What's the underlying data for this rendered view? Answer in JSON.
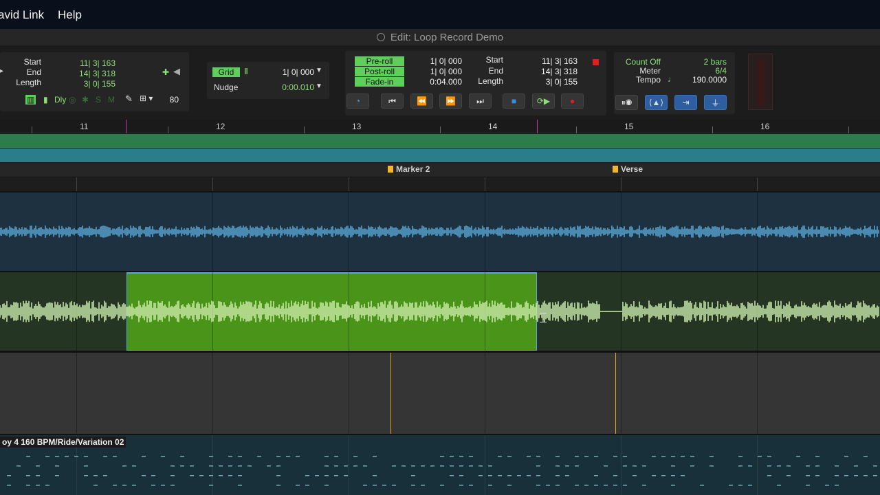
{
  "menu": {
    "items": [
      "avid Link",
      "Help"
    ]
  },
  "window": {
    "title": "Edit: Loop Record Demo"
  },
  "edit_selection": {
    "start_label": "Start",
    "start_value": "11| 3| 163",
    "end_label": "End",
    "end_value": "14| 3| 318",
    "length_label": "Length",
    "length_value": "3| 0| 155",
    "dly_label": "Dly",
    "s_label": "S",
    "m_label": "M",
    "zoom_value": "80"
  },
  "grid_nudge": {
    "grid_label": "Grid",
    "grid_value": "1| 0| 000",
    "nudge_label": "Nudge",
    "nudge_value": "0:00.010"
  },
  "transport": {
    "preroll_label": "Pre-roll",
    "preroll_value": "1| 0| 000",
    "postroll_label": "Post-roll",
    "postroll_value": "1| 0| 000",
    "fadein_label": "Fade-in",
    "fadein_value": "0:04.000",
    "start_label": "Start",
    "start_value": "11| 3| 163",
    "end_label": "End",
    "end_value": "14| 3| 318",
    "length_label": "Length",
    "length_value": "3| 0| 155"
  },
  "counter": {
    "countoff_label": "Count Off",
    "countoff_value": "2 bars",
    "meter_label": "Meter",
    "meter_value": "6/4",
    "tempo_label": "Tempo",
    "tempo_value": "190.0000"
  },
  "ruler": {
    "bars": [
      "11",
      "12",
      "13",
      "14",
      "15",
      "16"
    ]
  },
  "markers": [
    {
      "name": "Marker 2"
    },
    {
      "name": "Verse"
    }
  ],
  "midi_track": {
    "clip_name": "oy 4 160 BPM/Ride/Variation 02"
  },
  "colors": {
    "audio_blue": "#5aa9d6",
    "audio_green": "#9fdc6a",
    "selection": "#4a9519",
    "marker": "#f1b62b"
  }
}
